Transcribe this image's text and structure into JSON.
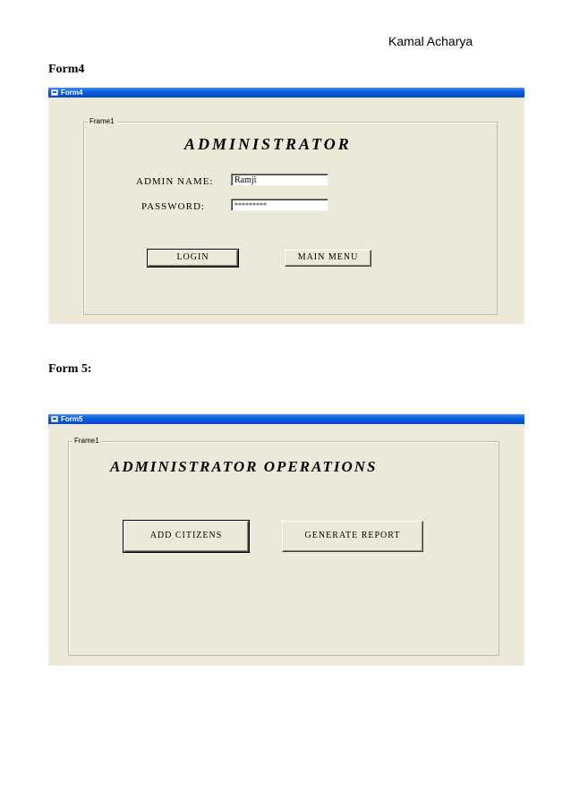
{
  "author": "Kamal Acharya",
  "form4": {
    "caption": "Form4",
    "window_title": "Form4",
    "frame_label": "Frame1",
    "heading": "ADMINISTRATOR",
    "admin_name_label": "ADMIN NAME:",
    "admin_name_value": "Ramji",
    "password_label": "PASSWORD:",
    "password_value": "*********",
    "login_button": "LOGIN",
    "main_menu_button": "MAIN MENU"
  },
  "form5": {
    "caption": "Form 5:",
    "window_title": "Form5",
    "frame_label": "Frame1",
    "heading": "ADMINISTRATOR OPERATIONS",
    "add_citizens_button": "ADD CITIZENS",
    "generate_report_button": "GENERATE REPORT"
  },
  "colors": {
    "window_bg": "#ece9d8",
    "titlebar": "#0a5fe0"
  },
  "icons": [
    "window-app-icon"
  ]
}
